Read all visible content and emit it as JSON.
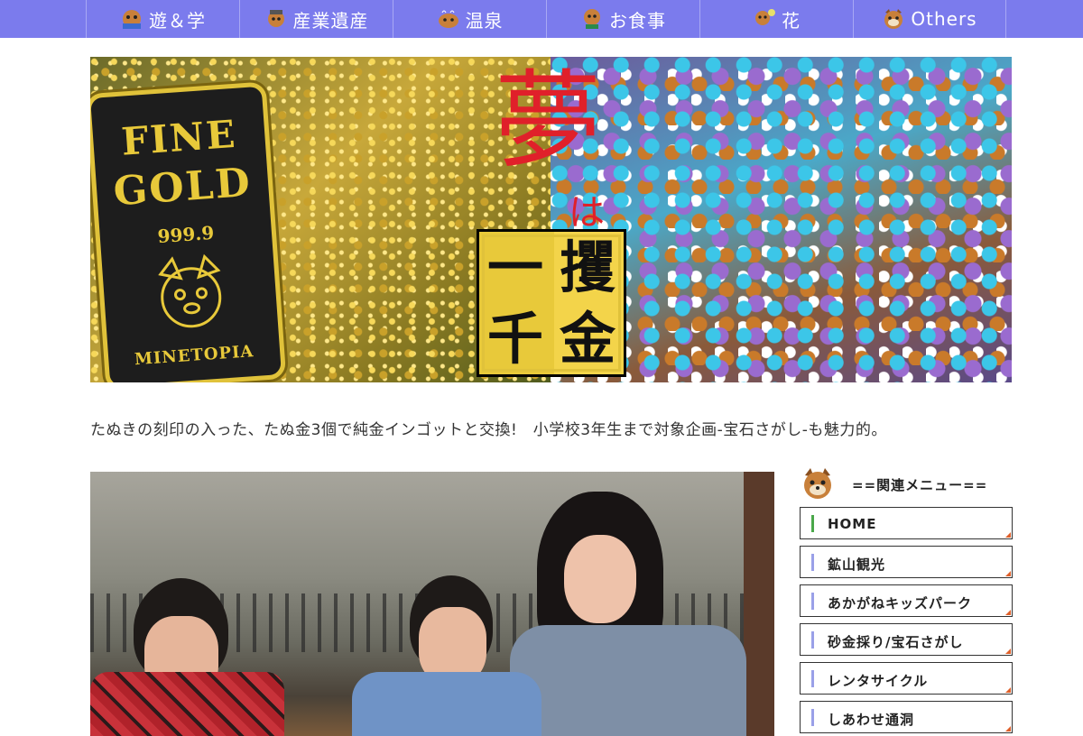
{
  "nav": {
    "items": [
      {
        "label": "遊＆学",
        "icon": "tanuki-play-icon"
      },
      {
        "label": "産業遺産",
        "icon": "tanuki-miner-icon"
      },
      {
        "label": "温泉",
        "icon": "tanuki-onsen-icon"
      },
      {
        "label": "お食事",
        "icon": "tanuki-food-icon"
      },
      {
        "label": "花",
        "icon": "tanuki-flower-icon"
      },
      {
        "label": "Others",
        "icon": "tanuki-face-icon"
      }
    ]
  },
  "hero": {
    "bar_line1": "FINE",
    "bar_line2": "GOLD",
    "bar_purity": "999.9",
    "bar_brand": "MINETOPIA",
    "headline_yume": "夢",
    "headline_ha": "は",
    "kin_chars": [
      "一",
      "攫",
      "千",
      "金"
    ]
  },
  "description": "たぬきの刻印の入った、たぬ金3個で純金インゴットと交換!　小学校3年生まで対象企画-宝石さがし-も魅力的。",
  "sidebar": {
    "heading": "==関連メニュー==",
    "items": [
      {
        "label": "HOME"
      },
      {
        "label": "鉱山観光"
      },
      {
        "label": "あかがねキッズパーク"
      },
      {
        "label": "砂金採り/宝石さがし"
      },
      {
        "label": "レンタサイクル"
      },
      {
        "label": "しあわせ通洞"
      }
    ]
  },
  "colors": {
    "nav_bg": "#7b7bed",
    "home_accent": "#4aa84a",
    "menu_accent": "#9aa0e8",
    "headline_red": "#e0202a",
    "gold": "#e8c93a"
  }
}
